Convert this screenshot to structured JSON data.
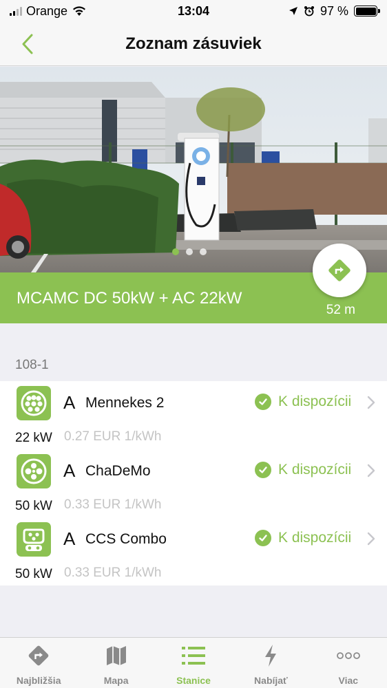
{
  "status_bar": {
    "carrier": "Orange",
    "time": "13:04",
    "battery": "97 %"
  },
  "nav": {
    "title": "Zoznam zásuviek"
  },
  "gallery": {
    "page_count": 3,
    "current_page": 1
  },
  "station": {
    "name": "MCAMC DC 50kW + AC 22kW",
    "distance": "52 m"
  },
  "section": {
    "label": "108-1"
  },
  "sockets": [
    {
      "letter": "A",
      "type": "Mennekes 2",
      "status": "K dispozícii",
      "power": "22 kW",
      "price": "0.27 EUR 1/kWh",
      "icon": "type2-connector-icon"
    },
    {
      "letter": "A",
      "type": "ChaDeMo",
      "status": "K dispozícii",
      "power": "50 kW",
      "price": "0.33 EUR 1/kWh",
      "icon": "chademo-connector-icon"
    },
    {
      "letter": "A",
      "type": "CCS Combo",
      "status": "K dispozícii",
      "power": "50 kW",
      "price": "0.33 EUR 1/kWh",
      "icon": "ccs-combo-connector-icon"
    }
  ],
  "tabs": [
    {
      "label": "Najbližšia",
      "icon": "nearest-directions-icon",
      "active": false
    },
    {
      "label": "Mapa",
      "icon": "map-icon",
      "active": false
    },
    {
      "label": "Stanice",
      "icon": "list-icon",
      "active": true
    },
    {
      "label": "Nabíjať",
      "icon": "lightning-icon",
      "active": false
    },
    {
      "label": "Viac",
      "icon": "more-dots-icon",
      "active": false
    }
  ],
  "colors": {
    "accent": "#8cc152",
    "price_text": "#c4c4c4",
    "section_label": "#777777"
  }
}
